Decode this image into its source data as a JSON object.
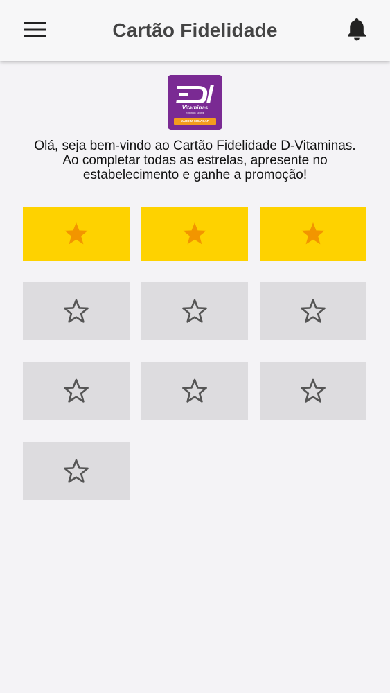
{
  "header": {
    "title": "Cartão Fidelidade",
    "menu_icon": "menu-icon",
    "notification_icon": "bell-icon"
  },
  "logo": {
    "brand_line": "Vitaminas",
    "tagline": "nutrition sports",
    "badge": "JARDIM SULACAP"
  },
  "welcome_text": "Olá, seja bem-vindo ao Cartão Fidelidade D-Vitaminas. Ao completar todas as estrelas, apresente no estabelecimento e ganhe a promoção!",
  "loyalty": {
    "total_stars": 10,
    "filled_stars": 3
  },
  "colors": {
    "filled_background": "#fed200",
    "filled_star": "#f29500",
    "empty_background": "#dddcdf",
    "empty_star": "#555555",
    "logo_background": "#7a2a93",
    "logo_badge": "#f39c1e"
  }
}
